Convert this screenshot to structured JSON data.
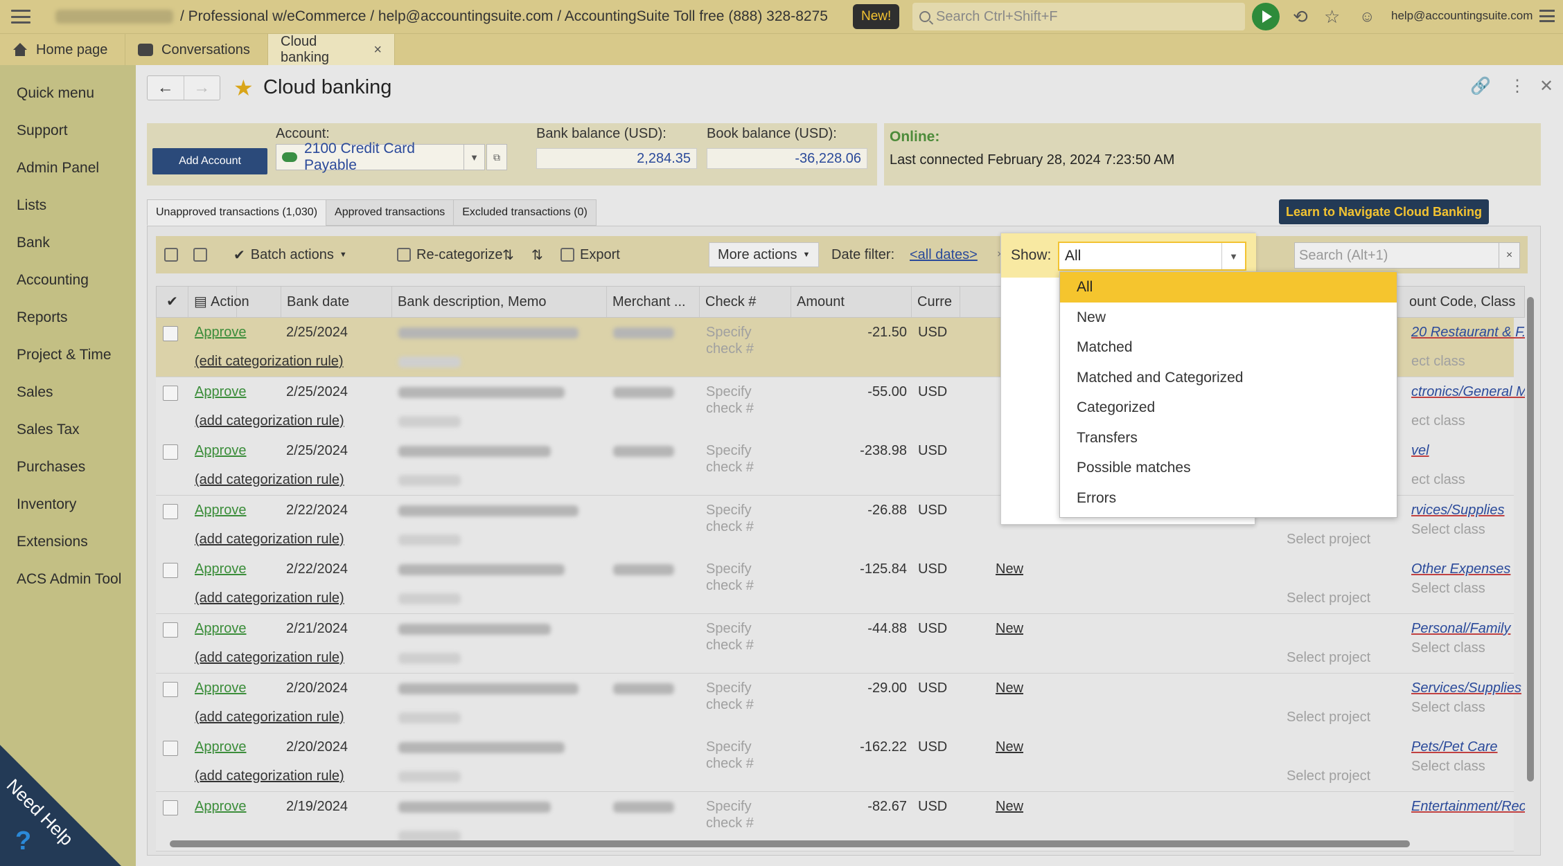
{
  "topbar": {
    "app_title": "/ Professional w/eCommerce / help@accountingsuite.com / AccountingSuite Toll free (888) 328-8275",
    "new_badge": "New!",
    "search_placeholder": "Search Ctrl+Shift+F",
    "user_email": "help@accountingsuite.com",
    "icons": [
      "menu-icon",
      "play-icon",
      "history-icon",
      "star-icon",
      "user-icon",
      "more-menu-icon"
    ]
  },
  "tabs": [
    {
      "label": "Home page",
      "icon": "home-icon"
    },
    {
      "label": "Conversations",
      "icon": "conversations-icon"
    },
    {
      "label": "Cloud banking",
      "active": true,
      "close": "×"
    }
  ],
  "sidebar": {
    "items": [
      "Quick menu",
      "Support",
      "Admin Panel",
      "Lists",
      "Bank",
      "Accounting",
      "Reports",
      "Project & Time",
      "Sales",
      "Sales Tax",
      "Purchases",
      "Inventory",
      "Extensions",
      "ACS Admin Tool"
    ],
    "help_label": "Need Help",
    "help_glyph": "?"
  },
  "page": {
    "title": "Cloud banking",
    "add_account": "Add Account",
    "account_label": "Account:",
    "account_value": "2100 Credit Card Payable",
    "bank_balance_label": "Bank balance (USD):",
    "bank_balance": "2,284.35",
    "book_balance_label": "Book balance (USD):",
    "book_balance": "-36,228.06",
    "online_label": "Online:",
    "last_connected": "Last connected February 28, 2024 7:23:50 AM",
    "learn_button": "Learn to Navigate Cloud Banking"
  },
  "ttabs": [
    {
      "label": "Unapproved transactions (1,030)",
      "active": true
    },
    {
      "label": "Approved transactions"
    },
    {
      "label": "Excluded transactions (0)"
    }
  ],
  "toolbar": {
    "batch_actions": "Batch actions",
    "recategorize": "Re-categorize",
    "export": "Export",
    "more_actions": "More actions",
    "date_filter_label": "Date filter:",
    "date_filter_value": "<all dates>",
    "clear": "×",
    "show_label": "Show:",
    "show_value": "All",
    "search_placeholder": "Search (Alt+1)",
    "search_clear": "×"
  },
  "columns": [
    "Action",
    "Bank date",
    "Bank description, Memo",
    "Merchant ...",
    "Check #",
    "Amount",
    "Curre",
    "ount Code, Class"
  ],
  "rows": [
    {
      "approve": "Approve",
      "rule": "(edit categorization rule)",
      "date": "2/25/2024",
      "check": "Specify",
      "check2": "check #",
      "amount": "-21.50",
      "currency": "USD",
      "account": "20 Restaurant & F...",
      "class": "ect class",
      "highlight": true
    },
    {
      "approve": "Approve",
      "rule": "(add categorization rule)",
      "date": "2/25/2024",
      "check": "Specify",
      "check2": "check #",
      "amount": "-55.00",
      "currency": "USD",
      "account": "ctronics/General M",
      "class": "ect class"
    },
    {
      "approve": "Approve",
      "rule": "(add categorization rule)",
      "date": "2/25/2024",
      "check": "Specify",
      "check2": "check #",
      "amount": "-238.98",
      "currency": "USD",
      "account": "vel",
      "class": "ect class"
    },
    {
      "approve": "Approve",
      "rule": "(add categorization rule)",
      "date": "2/22/2024",
      "check": "Specify",
      "check2": "check #",
      "amount": "-26.88",
      "currency": "USD",
      "status": "",
      "project": "Select project",
      "account": "rvices/Supplies",
      "class": "Select class"
    },
    {
      "approve": "Approve",
      "rule": "(add categorization rule)",
      "date": "2/22/2024",
      "check": "Specify",
      "check2": "check #",
      "amount": "-125.84",
      "currency": "USD",
      "status": "New",
      "project": "Select project",
      "account": "Other Expenses",
      "class": "Select class"
    },
    {
      "approve": "Approve",
      "rule": "(add categorization rule)",
      "date": "2/21/2024",
      "check": "Specify",
      "check2": "check #",
      "amount": "-44.88",
      "currency": "USD",
      "status": "New",
      "project": "Select project",
      "account": "Personal/Family",
      "class": "Select class"
    },
    {
      "approve": "Approve",
      "rule": "(add categorization rule)",
      "date": "2/20/2024",
      "check": "Specify",
      "check2": "check #",
      "amount": "-29.00",
      "currency": "USD",
      "status": "New",
      "project": "Select project",
      "account": "Services/Supplies",
      "class": "Select class"
    },
    {
      "approve": "Approve",
      "rule": "(add categorization rule)",
      "date": "2/20/2024",
      "check": "Specify",
      "check2": "check #",
      "amount": "-162.22",
      "currency": "USD",
      "status": "New",
      "project": "Select project",
      "account": "Pets/Pet Care",
      "class": "Select class"
    },
    {
      "approve": "Approve",
      "rule": "",
      "date": "2/19/2024",
      "check": "Specify",
      "check2": "check #",
      "amount": "-82.67",
      "currency": "USD",
      "status": "New",
      "project": "",
      "account": "Entertainment/Recrea",
      "class": ""
    }
  ],
  "show_options": [
    "All",
    "New",
    "Matched",
    "Matched and Categorized",
    "Categorized",
    "Transfers",
    "Possible matches",
    "Errors"
  ],
  "colors": {
    "accent": "#f5c52e",
    "nav": "#233a56",
    "approve": "#3b8d3a",
    "link": "#2b4a9a"
  }
}
